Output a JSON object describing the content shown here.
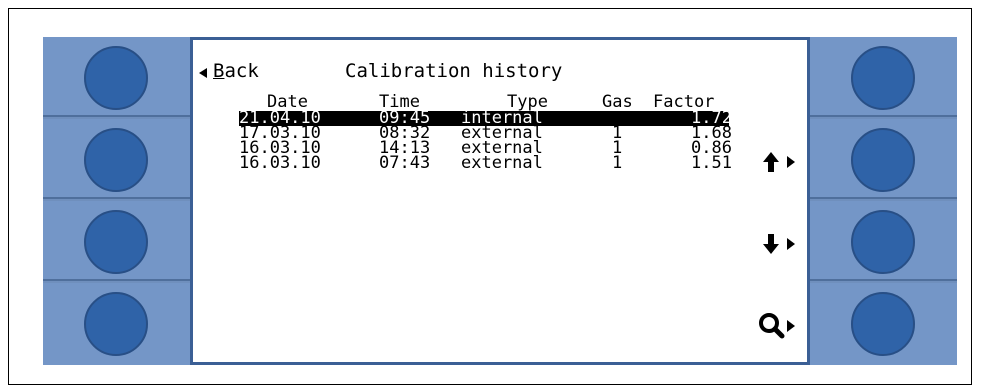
{
  "header": {
    "back_label_prefix": "",
    "back_label_underlined": "B",
    "back_label_rest": "ack",
    "title": "Calibration history"
  },
  "table": {
    "columns": [
      "Date",
      "Time",
      "Type",
      "Gas",
      "Factor"
    ],
    "rows": [
      {
        "date": "21.04.10",
        "time": "09:45",
        "type": "internal",
        "gas": "",
        "factor": "1.72",
        "selected": true
      },
      {
        "date": "17.03.10",
        "time": "08:32",
        "type": "external",
        "gas": "1",
        "factor": "1.68",
        "selected": false
      },
      {
        "date": "16.03.10",
        "time": "14:13",
        "type": "external",
        "gas": "1",
        "factor": "0.86",
        "selected": false
      },
      {
        "date": "16.03.10",
        "time": "07:43",
        "type": "external",
        "gas": "1",
        "factor": "1.51",
        "selected": false
      }
    ]
  },
  "side_actions": [
    {
      "name": "scroll-up",
      "icon": "arrow-up-icon"
    },
    {
      "name": "scroll-down",
      "icon": "arrow-down-icon"
    },
    {
      "name": "zoom",
      "icon": "magnifier-icon"
    }
  ],
  "colors": {
    "panel": "#7496c7",
    "knob": "#2f63a8",
    "screen_border": "#3b5f95",
    "selection": "#000000"
  }
}
